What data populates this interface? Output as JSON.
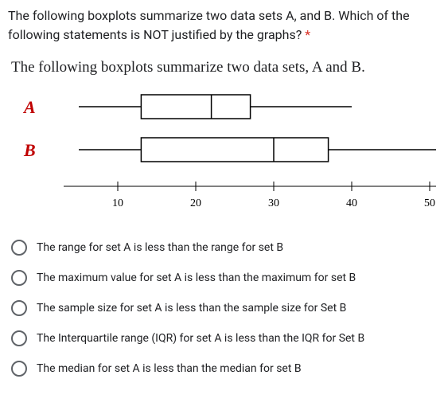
{
  "question": {
    "text": "The following boxplots summarize two data sets A, and B. Which of the following statements is NOT justified by the graphs?",
    "required_marker": "*"
  },
  "figure_title": "The following boxplots summarize two data sets, A and B.",
  "chart_data": {
    "type": "boxplot",
    "x_axis": {
      "min": 5,
      "max": 55,
      "ticks": [
        10,
        20,
        30,
        40,
        50
      ]
    },
    "series": [
      {
        "name": "A",
        "min": 5,
        "q1": 13,
        "median": 22,
        "q3": 27,
        "max": 40
      },
      {
        "name": "B",
        "min": 5,
        "q1": 13,
        "median": 30,
        "q3": 37,
        "max": 55
      }
    ]
  },
  "options": [
    {
      "label": "The range for set A is less than the range for set B"
    },
    {
      "label": "The maximum value for set A is less than the maximum for set B"
    },
    {
      "label": "The sample size for set A is less than the sample size for Set B"
    },
    {
      "label": "The Interquartile range (IQR) for set A is less than the IQR for Set B"
    },
    {
      "label": "The median for set A is less than the median for set B"
    }
  ]
}
